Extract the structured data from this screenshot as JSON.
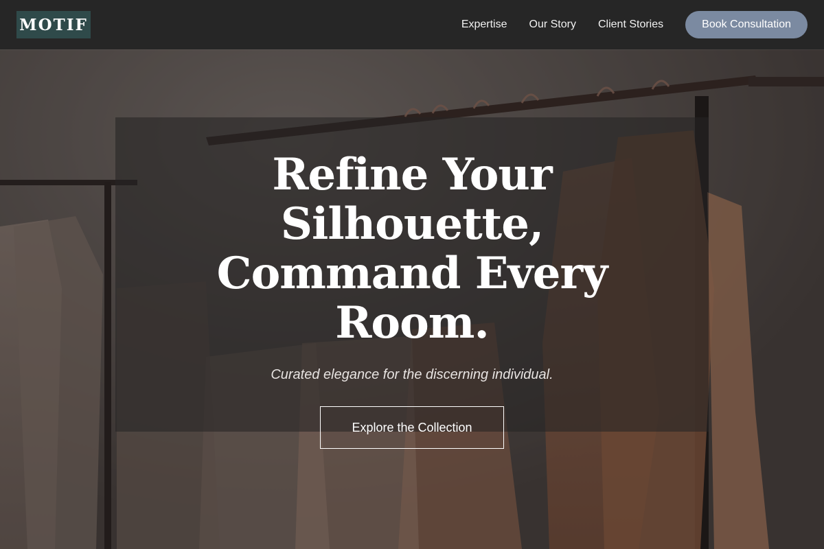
{
  "header": {
    "logo": "MOTIF",
    "nav": [
      {
        "label": "Expertise"
      },
      {
        "label": "Our Story"
      },
      {
        "label": "Client Stories"
      }
    ],
    "cta_label": "Book Consultation"
  },
  "hero": {
    "title_line_1": "Refine Your Silhouette,",
    "title_line_2": "Command Every",
    "title_line_3": "Room.",
    "subtitle": "Curated elegance for the discerning individual.",
    "cta_label": "Explore the Collection"
  },
  "colors": {
    "header_bg": "#262626",
    "logo_bg": "#2f4a4a",
    "cta_bg": "#7b8aa1",
    "panel_overlay": "rgba(38,36,36,0.58)"
  }
}
